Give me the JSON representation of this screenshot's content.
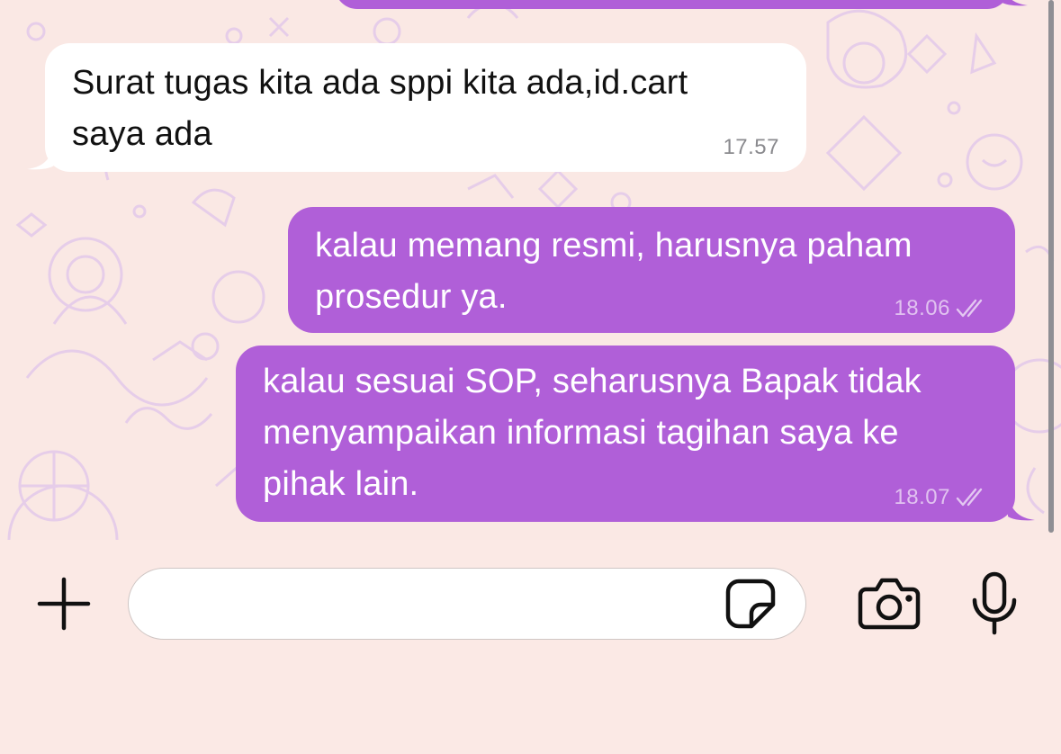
{
  "messages": [
    {
      "direction": "incoming",
      "text": "Surat tugas kita ada sppi kita ada,id.cart\nsaya ada",
      "time": "17.57"
    },
    {
      "direction": "outgoing",
      "text": "kalau memang resmi, harusnya paham\nprosedur ya.",
      "time": "18.06",
      "status": "read-checkmarks"
    },
    {
      "direction": "outgoing",
      "text": "kalau sesuai SOP, seharusnya Bapak tidak\nmenyampaikan informasi tagihan saya ke\npihak lain.",
      "time": "18.07",
      "status": "read-checkmarks"
    }
  ],
  "composer": {
    "input_value": "",
    "input_placeholder": "",
    "icons": [
      "plus-icon",
      "sticker-icon",
      "camera-icon",
      "microphone-icon"
    ]
  },
  "colors": {
    "outgoing_bubble": "#b05fd8",
    "incoming_bubble": "#ffffff",
    "chat_background": "#fae8e4",
    "wallpaper_doodle": "#e3c9e9"
  }
}
